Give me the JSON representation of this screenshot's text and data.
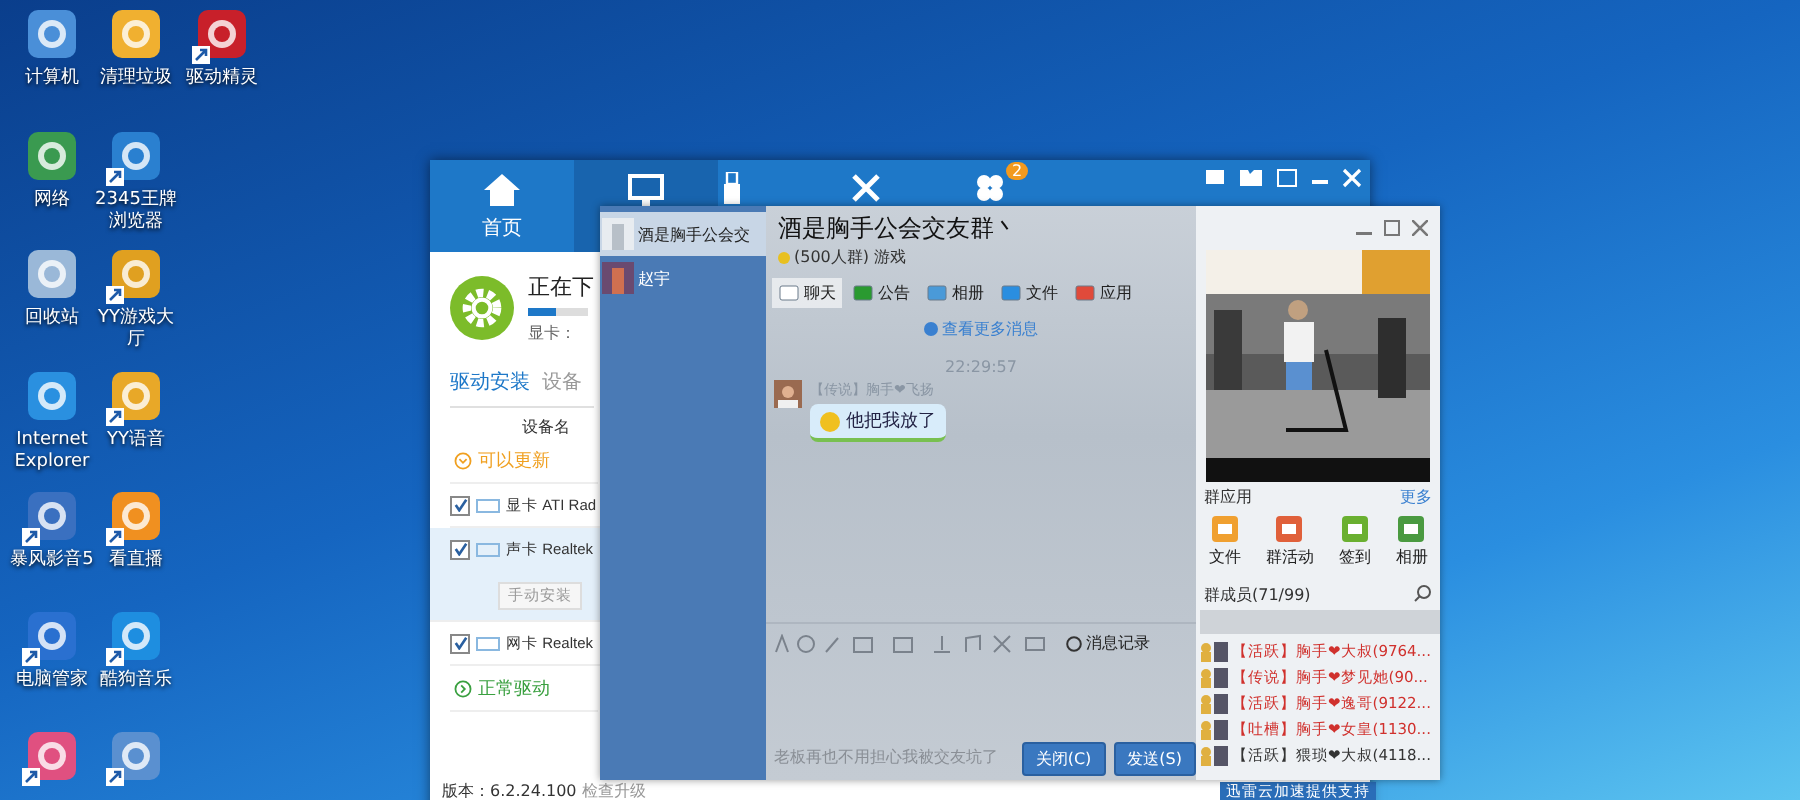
{
  "desktop_icons": [
    {
      "label": "计算机",
      "shortcut": false
    },
    {
      "label": "清理垃圾",
      "shortcut": false
    },
    {
      "label": "驱动精灵",
      "shortcut": true
    },
    {
      "label": "网络",
      "shortcut": false
    },
    {
      "label": "2345王牌浏览器",
      "shortcut": true
    },
    {
      "label": "回收站",
      "shortcut": false
    },
    {
      "label": "YY游戏大厅",
      "shortcut": true
    },
    {
      "label": "Internet Explorer",
      "shortcut": false
    },
    {
      "label": "YY语音",
      "shortcut": true
    },
    {
      "label": "暴风影音5",
      "shortcut": true
    },
    {
      "label": "看直播",
      "shortcut": true
    },
    {
      "label": "电脑管家",
      "shortcut": true
    },
    {
      "label": "酷狗音乐",
      "shortcut": true
    },
    {
      "shortcut": true
    },
    {
      "shortcut": true
    }
  ],
  "driver_window": {
    "nav": [
      {
        "label": "首页",
        "selected": false
      },
      {
        "selected": true
      }
    ],
    "badge": "2",
    "status_title": "正在下",
    "status_detail": "显卡：",
    "progress": {
      "level": 0.45
    },
    "tabs": [
      {
        "label": "驱动安装",
        "selected": true
      },
      {
        "label": "设备",
        "selected": false
      }
    ],
    "column_header": "设备名",
    "groups": [
      {
        "title": "可以更新",
        "kind": "update",
        "devices": [
          {
            "type": "显卡",
            "name": "ATI Rad",
            "checked": true
          },
          {
            "type": "声卡",
            "name": "Realtek",
            "checked": true,
            "action": "手动安装"
          },
          {
            "type": "网卡",
            "name": "Realtek",
            "checked": true
          }
        ]
      },
      {
        "title": "正常驱动",
        "kind": "normal"
      }
    ],
    "version": "版本：6.2.24.100",
    "upgrade_link": "检查升级",
    "footer_note": "迅雷云加速提供支持"
  },
  "chat_list": [
    {
      "name": "酒是胸手公会交",
      "selected": true
    },
    {
      "name": "赵宇",
      "selected": false
    }
  ],
  "chat_window": {
    "title": "酒是胸手公会交友群丶",
    "subtitle": "(500人群) 游戏",
    "tabs": [
      {
        "label": "聊天",
        "selected": true
      },
      {
        "label": "公告",
        "selected": false
      },
      {
        "label": "相册",
        "selected": false
      },
      {
        "label": "文件",
        "selected": false
      },
      {
        "label": "应用",
        "selected": false
      }
    ],
    "more_messages": "查看更多消息",
    "time": "22:29:57",
    "messages": [
      {
        "sender": "【传说】胸手❤飞扬",
        "text": "他把我放了"
      }
    ],
    "history_button": "消息记录",
    "input": {
      "placeholder": "老板再也不用担心我被交友坑了"
    },
    "buttons": [
      {
        "label": "关闭(C)"
      },
      {
        "label": "发送(S)"
      }
    ],
    "apps_title": "群应用",
    "apps_more": "更多",
    "apps": [
      {
        "label": "文件"
      },
      {
        "label": "群活动"
      },
      {
        "label": "签到"
      },
      {
        "label": "相册"
      }
    ],
    "members_title": "群成员(71/99)",
    "members": [
      {
        "name": "【活跃】胸手❤大叔(9764...",
        "color": "#d0312d"
      },
      {
        "name": "【传说】胸手❤梦见她(90...",
        "color": "#d0312d"
      },
      {
        "name": "【活跃】胸手❤逸哥(9122...",
        "color": "#d0312d"
      },
      {
        "name": "【吐槽】胸手❤女皇(1130...",
        "color": "#d0312d"
      },
      {
        "name": "【活跃】猥琐❤大叔(4118...",
        "color": "#333333"
      }
    ]
  }
}
